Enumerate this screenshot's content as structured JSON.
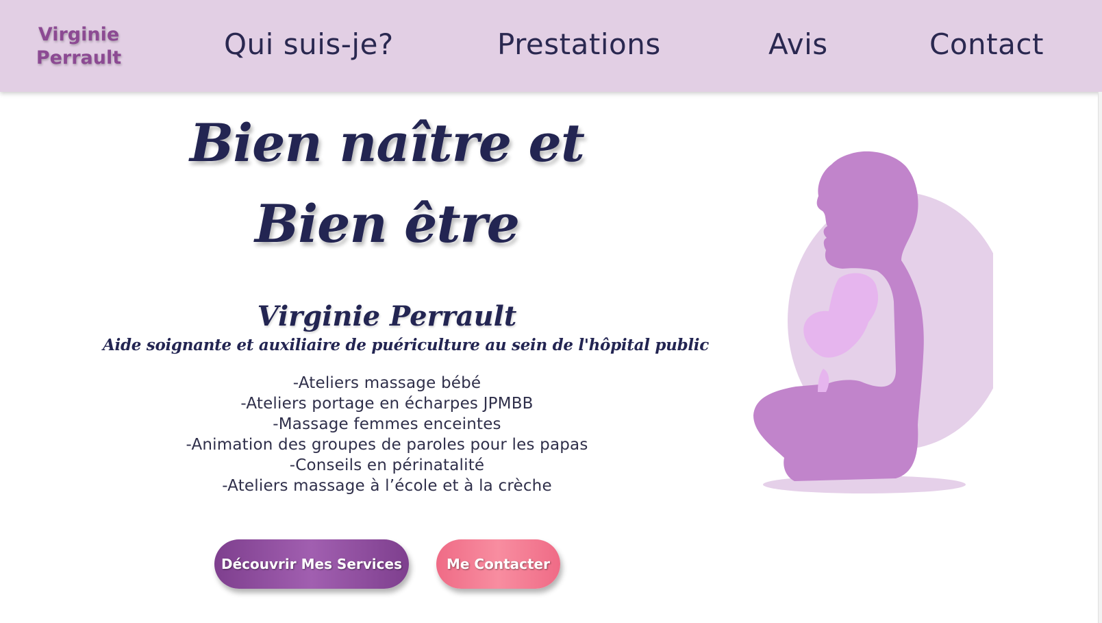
{
  "header": {
    "brand_line1": "Virginie",
    "brand_line2": "Perrault",
    "nav": [
      {
        "label": "Qui suis-je?"
      },
      {
        "label": "Prestations"
      },
      {
        "label": "Avis"
      },
      {
        "label": "Contact"
      }
    ]
  },
  "hero": {
    "title_line1": "Bien naître et",
    "title_line2": "Bien être",
    "name": "Virginie Perrault",
    "subtitle": "Aide soignante et auxiliaire de puériculture au sein de l'hôpital public",
    "services": [
      "-Ateliers massage bébé",
      "-Ateliers portage en écharpes JPMBB",
      "-Massage femmes enceintes",
      "-Animation des groupes de paroles pour les papas",
      "-Conseils en périnatalité",
      "-Ateliers massage à l’école et à la crèche"
    ]
  },
  "buttons": {
    "services_label": "Découvrir Mes Services",
    "contact_label": "Me Contacter"
  },
  "illustration": {
    "icon": "mother-holding-baby-silhouette-icon"
  },
  "colors": {
    "header_bg": "#e2cfe4",
    "brand": "#8c4a93",
    "nav_text": "#2a2850",
    "title_text": "#232552",
    "button_services": "#8e4c9d",
    "button_contact": "#f27a92",
    "silhouette": "#c184cb",
    "circle": "#e5d0e9",
    "baby": "#e6b5ee"
  }
}
